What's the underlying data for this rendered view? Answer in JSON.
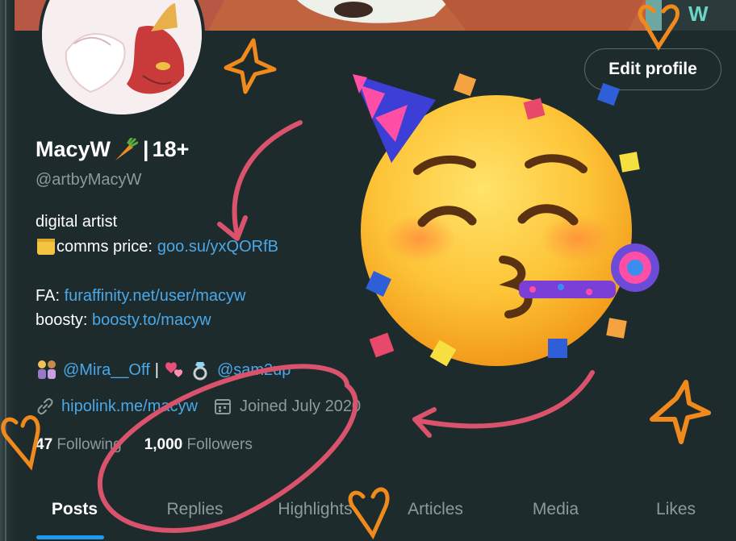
{
  "profile": {
    "display_name": "MacyW",
    "name_separator": "|",
    "age_tag": "18+",
    "handle": "@artbyMacyW",
    "edit_button_label": "Edit profile"
  },
  "bio": {
    "line1": "digital artist",
    "comms_label": "comms price:",
    "comms_link": "goo.su/yxQORfB",
    "fa_label": "FA:",
    "fa_link": "furaffinity.net/user/macyw",
    "boosty_label": "boosty:",
    "boosty_link": "boosty.to/macyw",
    "partner1": "@Mira__Off",
    "partner_sep": "|",
    "partner2": "@sam2up"
  },
  "meta": {
    "website": "hipolink.me/macyw",
    "joined": "Joined July 2020"
  },
  "stats": {
    "following_count": "47",
    "following_label": "Following",
    "followers_count": "1,000",
    "followers_label": "Followers"
  },
  "tabs": [
    "Posts",
    "Replies",
    "Highlights",
    "Articles",
    "Media",
    "Likes"
  ],
  "colors": {
    "background": "#1e2b2c",
    "link": "#4aa8e8",
    "accent_underline": "#1d9bf0",
    "annotation_pink": "#d9536c",
    "doodle_orange": "#f08a1c"
  },
  "icons": {
    "link": "link-icon",
    "calendar": "calendar-icon",
    "carrot": "carrot-emoji",
    "note": "note-emoji",
    "couple": "couple-emoji",
    "hearts": "hearts-emoji",
    "ring": "ring-emoji",
    "party": "partying-face-emoji"
  }
}
